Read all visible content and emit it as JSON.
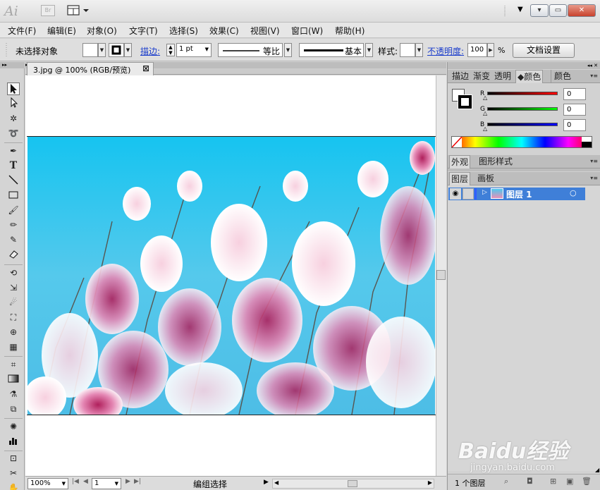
{
  "app": {
    "logo_text": "Ai",
    "bridge_label": "Br",
    "window_controls": [
      "▾",
      "▭",
      "✕"
    ]
  },
  "menu": [
    "文件(F)",
    "编辑(E)",
    "对象(O)",
    "文字(T)",
    "选择(S)",
    "效果(C)",
    "视图(V)",
    "窗口(W)",
    "帮助(H)"
  ],
  "control_bar": {
    "selection_status": "未选择对象",
    "stroke_link": "描边:",
    "stroke_weight": "1 pt",
    "profile_label": "等比",
    "brush_label": "基本",
    "style_label": "样式:",
    "opacity_link": "不透明度:",
    "opacity_value": "100",
    "opacity_unit": "%",
    "doc_setup_button": "文档设置"
  },
  "document": {
    "tab_title": "3.jpg @ 100% (RGB/预览)",
    "close_glyph": "⊠"
  },
  "status": {
    "zoom": "100%",
    "artboard_number": "1",
    "status_text": "编组选择"
  },
  "color_panel": {
    "tabs": [
      "描边",
      "渐变",
      "透明",
      "颜色",
      "颜色"
    ],
    "channels": [
      {
        "label": "R",
        "value": "0"
      },
      {
        "label": "G",
        "value": "0"
      },
      {
        "label": "B",
        "value": "0"
      }
    ]
  },
  "appearance_panel": {
    "tabs": [
      "外观",
      "图形样式"
    ]
  },
  "layers_panel": {
    "tabs": [
      "图层",
      "画板"
    ],
    "layers": [
      {
        "name": "图层 1",
        "visible": true
      }
    ],
    "count_label": "1 个图层"
  },
  "watermark": {
    "brand": "Baidu经验",
    "url": "jingyan.baidu.com"
  },
  "colors": {
    "selection_blue": "#3f7fd8",
    "sky": "#22c3ec",
    "link_blue": "#1a3ccb"
  }
}
